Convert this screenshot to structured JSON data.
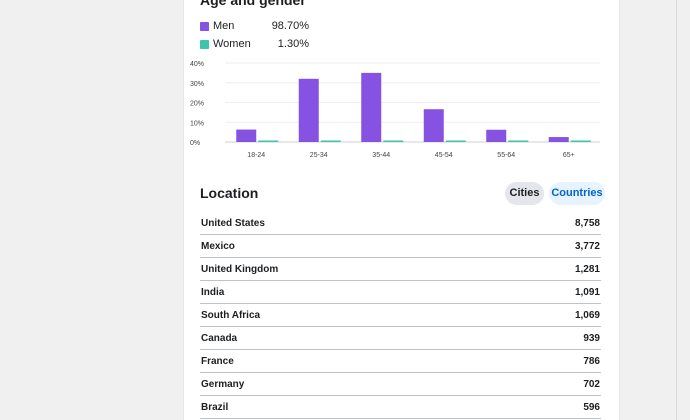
{
  "age_gender": {
    "title": "Age and gender",
    "legend": [
      {
        "name": "Men",
        "value": "98.70%",
        "color": "#8652e2"
      },
      {
        "name": "Women",
        "value": "1.30%",
        "color": "#3ec3ac"
      }
    ]
  },
  "chart_data": {
    "type": "bar",
    "categories": [
      "18-24",
      "25-34",
      "35-44",
      "45-54",
      "55-64",
      "65+"
    ],
    "series": [
      {
        "name": "Men",
        "color": "#8652e2",
        "values": [
          6.3,
          32.0,
          35.0,
          16.6,
          6.2,
          2.5
        ]
      },
      {
        "name": "Women",
        "color": "#3ec3ac",
        "values": [
          0.2,
          0.4,
          0.4,
          0.2,
          0.1,
          0.1
        ]
      }
    ],
    "yticks": [
      "0%",
      "10%",
      "20%",
      "30%",
      "40%"
    ],
    "ylim": [
      0,
      40
    ],
    "grid": true
  },
  "location": {
    "title": "Location",
    "tabs": {
      "cities": "Cities",
      "countries": "Countries"
    },
    "rows": [
      {
        "name": "United States",
        "value": "8,758"
      },
      {
        "name": "Mexico",
        "value": "3,772"
      },
      {
        "name": "United Kingdom",
        "value": "1,281"
      },
      {
        "name": "India",
        "value": "1,091"
      },
      {
        "name": "South Africa",
        "value": "1,069"
      },
      {
        "name": "Canada",
        "value": "939"
      },
      {
        "name": "France",
        "value": "786"
      },
      {
        "name": "Germany",
        "value": "702"
      },
      {
        "name": "Brazil",
        "value": "596"
      }
    ]
  }
}
